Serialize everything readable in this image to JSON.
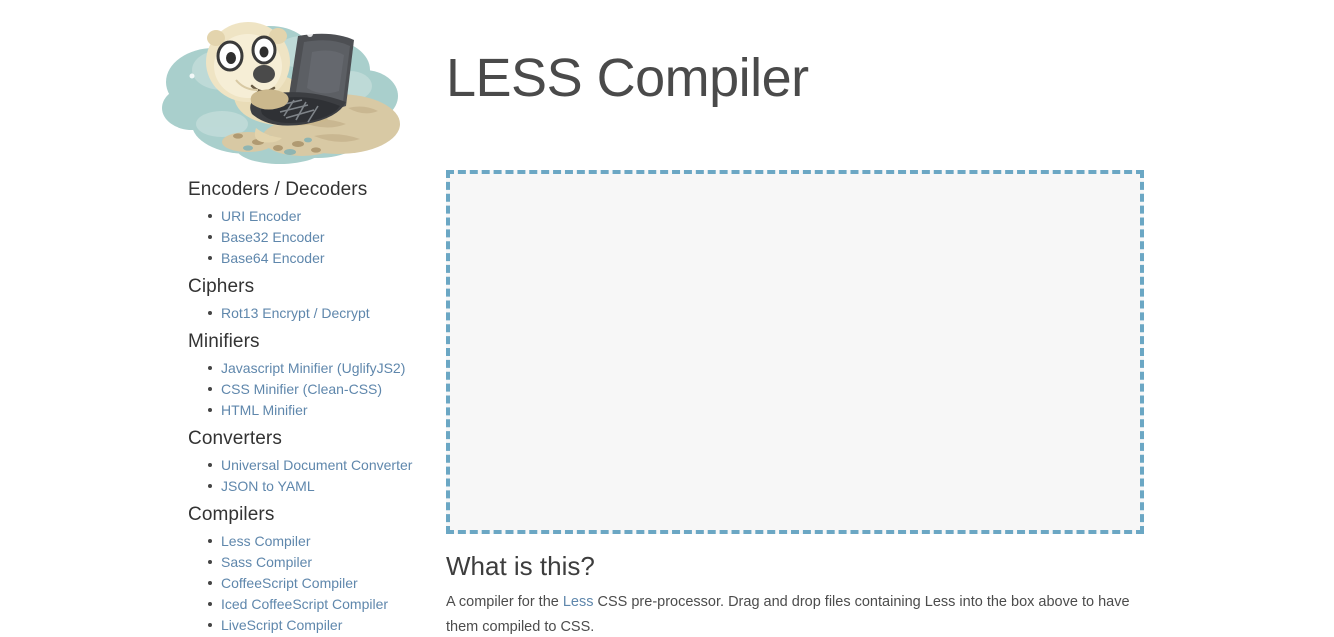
{
  "header": {
    "title": "LESS Compiler",
    "logo_alt": "sea-otter-with-laptop-logo"
  },
  "sidebar": {
    "sections": [
      {
        "heading": "Encoders / Decoders",
        "items": [
          {
            "label": "URI Encoder"
          },
          {
            "label": "Base32 Encoder"
          },
          {
            "label": "Base64 Encoder"
          }
        ]
      },
      {
        "heading": "Ciphers",
        "items": [
          {
            "label": "Rot13 Encrypt / Decrypt"
          }
        ]
      },
      {
        "heading": "Minifiers",
        "items": [
          {
            "label": "Javascript Minifier (UglifyJS2)"
          },
          {
            "label": "CSS Minifier (Clean-CSS)"
          },
          {
            "label": "HTML Minifier"
          }
        ]
      },
      {
        "heading": "Converters",
        "items": [
          {
            "label": "Universal Document Converter"
          },
          {
            "label": "JSON to YAML"
          }
        ]
      },
      {
        "heading": "Compilers",
        "items": [
          {
            "label": "Less Compiler"
          },
          {
            "label": "Sass Compiler"
          },
          {
            "label": "CoffeeScript Compiler"
          },
          {
            "label": "Iced CoffeeScript Compiler"
          },
          {
            "label": "LiveScript Compiler"
          }
        ]
      }
    ]
  },
  "main": {
    "dropzone": {
      "name": "file-drop-zone",
      "content": "",
      "border_color": "#6ba7c4",
      "fill_color": "#f7f7f7"
    },
    "about": {
      "heading": "What is this?",
      "text_before_link": "A compiler for the ",
      "link_label": "Less",
      "text_after_link": " CSS pre-processor. Drag and drop files containing Less into the box above to have them compiled to CSS."
    }
  },
  "colors": {
    "link": "#5f87ac",
    "heading": "#333333",
    "title": "#4a4a4a",
    "background": "#ffffff"
  }
}
